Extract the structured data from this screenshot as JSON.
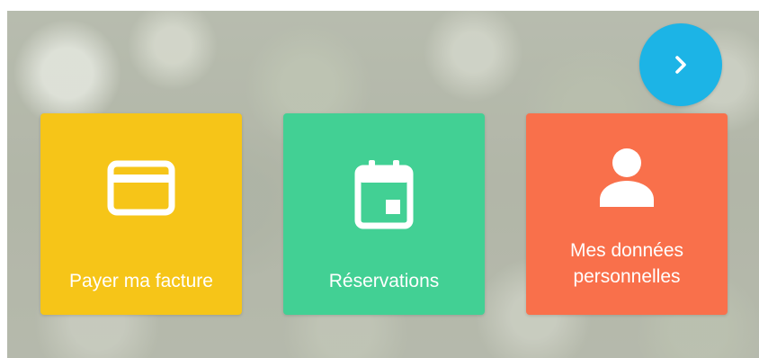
{
  "next_button": {
    "icon": "chevron-right-icon",
    "color": "#1cb4e6"
  },
  "tiles": [
    {
      "label": "Payer ma facture",
      "icon": "credit-card-icon",
      "color": "#f6c518"
    },
    {
      "label": "Réservations",
      "icon": "calendar-icon",
      "color": "#42d094"
    },
    {
      "label_line1": "Mes données",
      "label_line2": "personnelles",
      "icon": "person-icon",
      "color": "#f9704b"
    }
  ]
}
